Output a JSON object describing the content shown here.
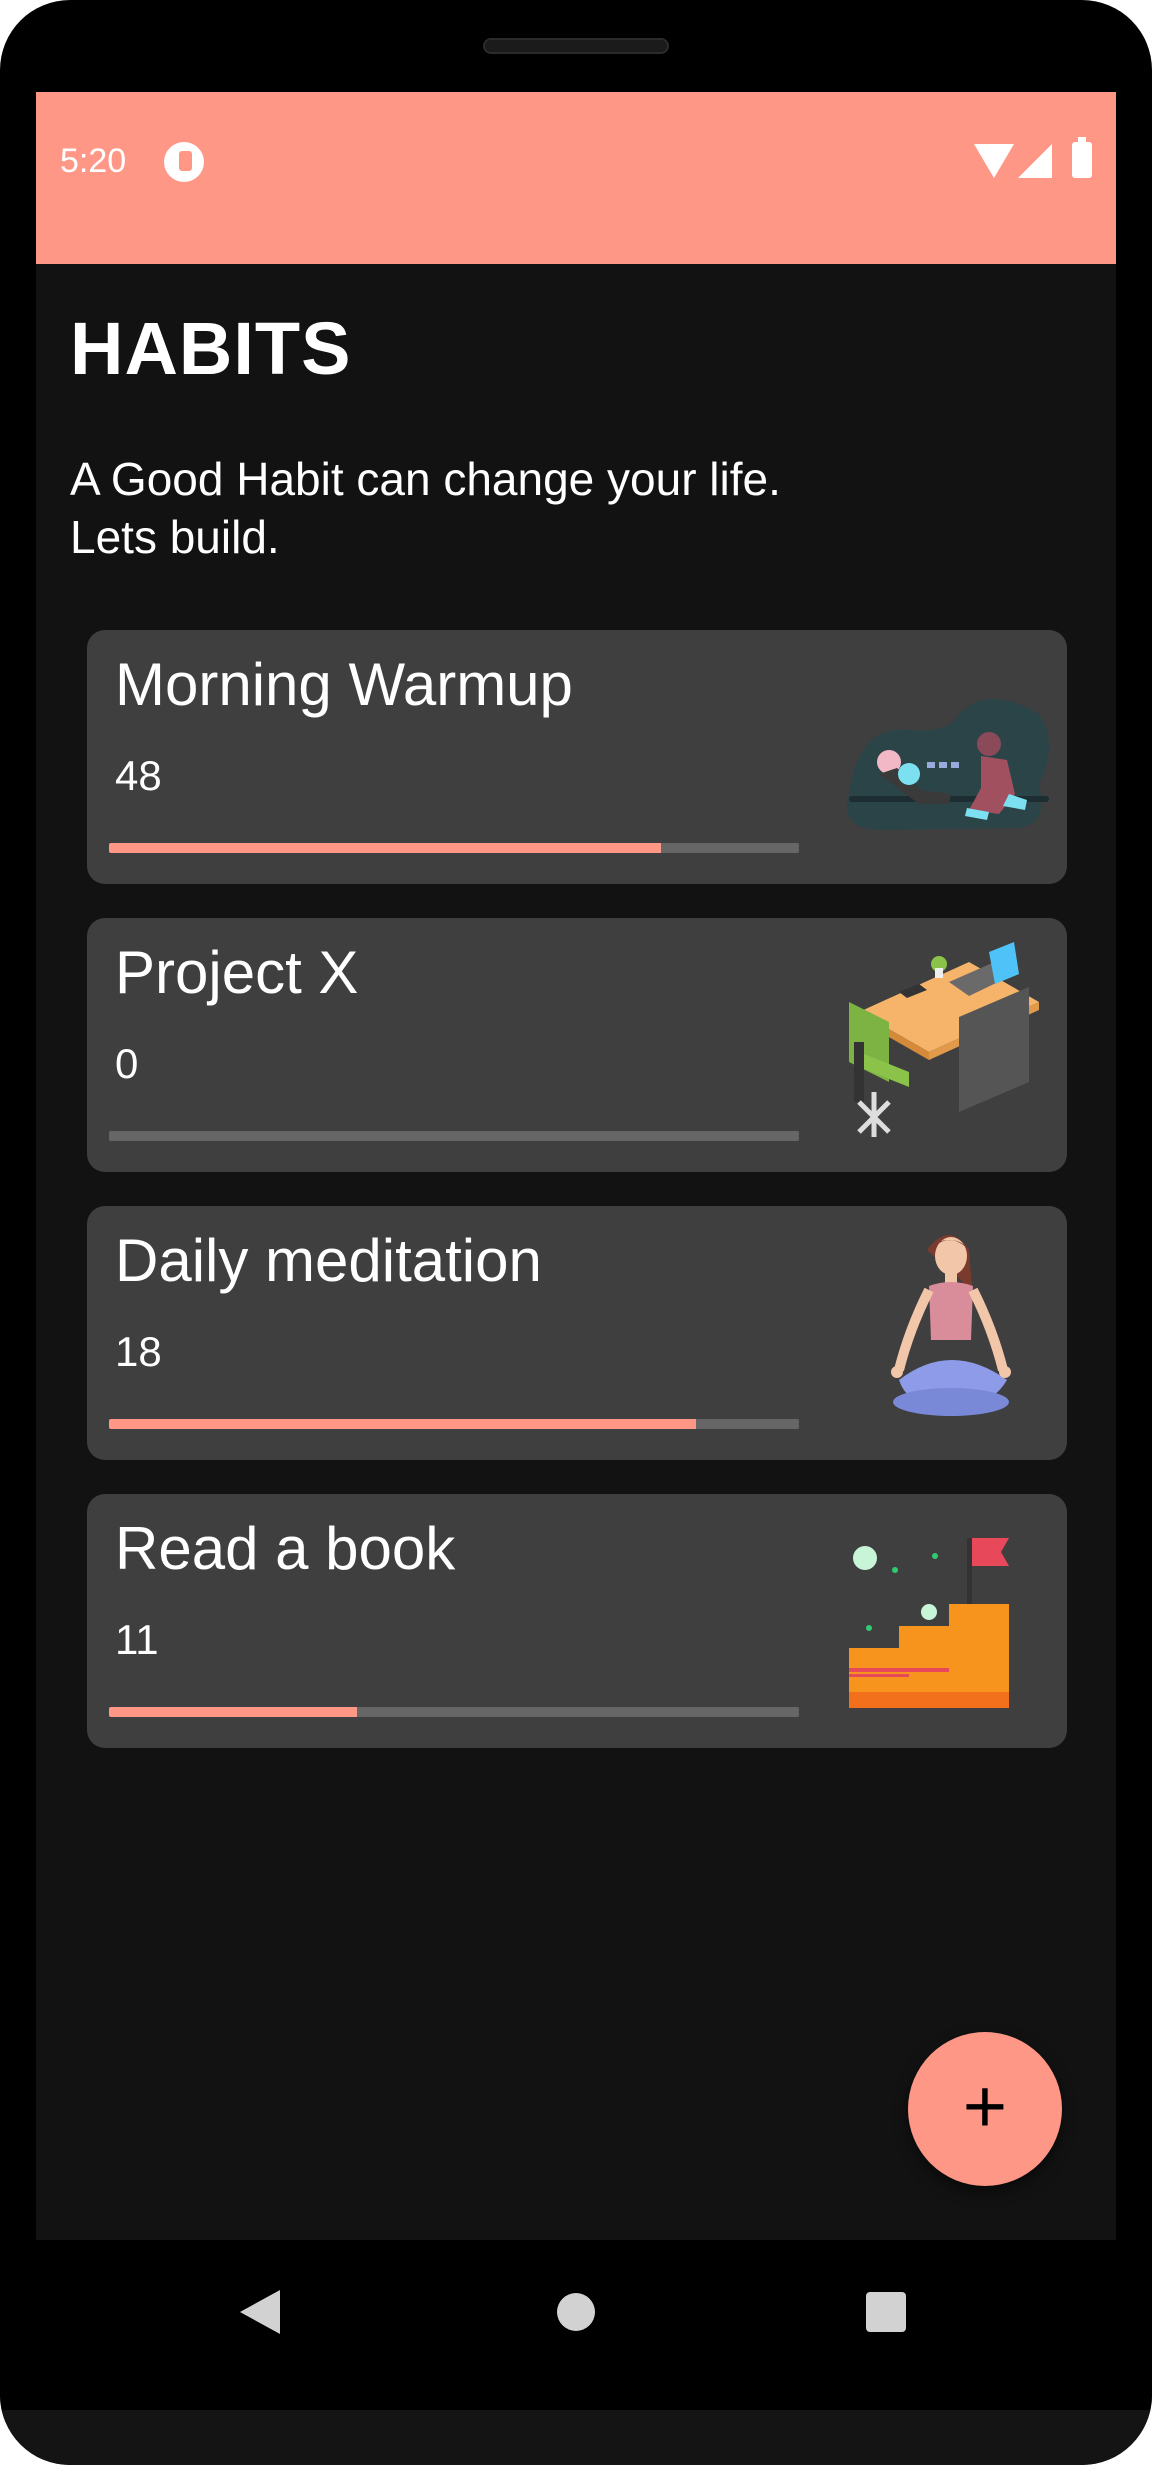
{
  "status_bar": {
    "time": "5:20"
  },
  "header": {
    "title": "HABITS",
    "subtitle_line1": "A Good Habit can change your life.",
    "subtitle_line2": "Lets build."
  },
  "habits": [
    {
      "name": "Morning Warmup",
      "count": "48",
      "progress": 0.8,
      "illustration": "workout-illustration"
    },
    {
      "name": "Project X",
      "count": "0",
      "progress": 0.0,
      "illustration": "desk-illustration"
    },
    {
      "name": "Daily meditation",
      "count": "18",
      "progress": 0.85,
      "illustration": "meditation-illustration"
    },
    {
      "name": "Read a book",
      "count": "11",
      "progress": 0.36,
      "illustration": "stairs-flag-illustration"
    }
  ],
  "fab": {
    "icon": "plus-icon",
    "label": "+"
  },
  "colors": {
    "accent": "#ff9787",
    "background": "#121212",
    "card": "#3f3f3f",
    "track": "#666666"
  },
  "nav": {
    "back_icon": "back-icon",
    "home_icon": "home-icon",
    "recents_icon": "recents-icon"
  }
}
